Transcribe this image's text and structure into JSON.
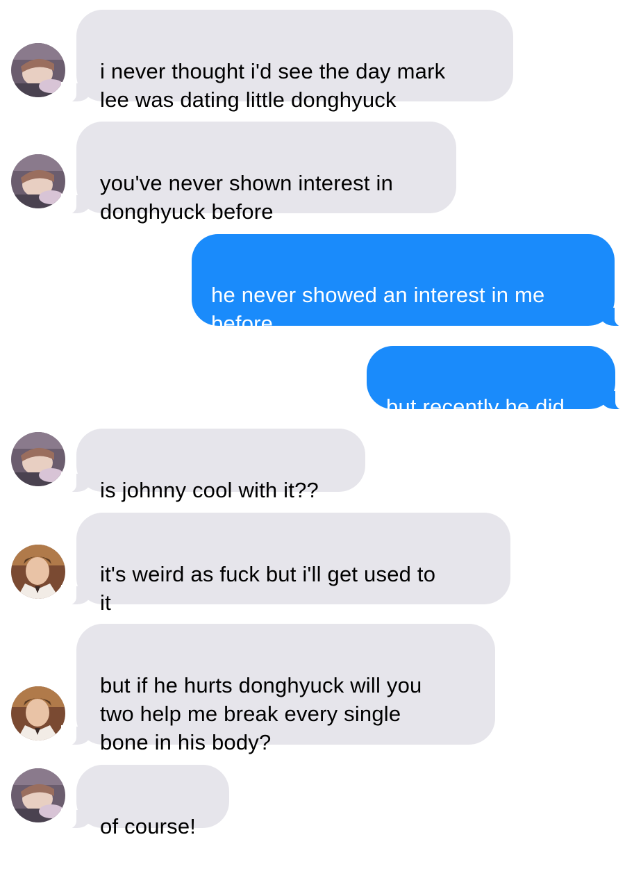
{
  "messages": [
    {
      "id": "m1",
      "direction": "incoming",
      "sender_avatar": "avatar-a",
      "text": "i never thought i'd see the day mark\nlee was dating little donghyuck"
    },
    {
      "id": "m2",
      "direction": "incoming",
      "sender_avatar": "avatar-a",
      "text": "you've never shown interest in\ndonghyuck before"
    },
    {
      "id": "m3",
      "direction": "outgoing",
      "text": "he never showed an interest in me\nbefore"
    },
    {
      "id": "m4",
      "direction": "outgoing",
      "text": "but recently he did"
    },
    {
      "id": "m5",
      "direction": "incoming",
      "sender_avatar": "avatar-a",
      "text": "is johnny cool with it??"
    },
    {
      "id": "m6",
      "direction": "incoming",
      "sender_avatar": "avatar-b",
      "text": "it's weird as fuck but i'll get used to\nit"
    },
    {
      "id": "m7",
      "direction": "incoming",
      "sender_avatar": "avatar-b",
      "text": "but if he hurts donghyuck will you\ntwo help me break every single\nbone in his body?"
    },
    {
      "id": "m8",
      "direction": "incoming",
      "sender_avatar": "avatar-a",
      "text": "of course!"
    }
  ],
  "colors": {
    "incoming_bubble": "#e6e5eb",
    "outgoing_bubble": "#1a8bfb",
    "incoming_text": "#000000",
    "outgoing_text": "#ffffff",
    "background": "#ffffff"
  },
  "icons": {
    "avatar_a": "contact-photo-avatar-a",
    "avatar_b": "contact-photo-avatar-b"
  }
}
